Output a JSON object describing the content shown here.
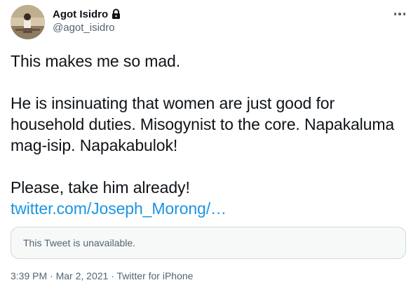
{
  "author": {
    "display_name": "Agot Isidro",
    "handle": "@agot_isidro",
    "protected_icon": "lock-icon",
    "avatar_icon": "profile-photo"
  },
  "menu": {
    "icon": "more-options-icon"
  },
  "tweet": {
    "line1": "This makes me so mad.",
    "paragraph2": "He is insinuating that women are just good for household duties. Misogynist to the core. Napakaluma mag-isip. Napakabulok!",
    "line3": "Please, take him already!",
    "link_text": "twitter.com/Joseph_Morong/…"
  },
  "quoted_tweet": {
    "text": "This Tweet is unavailable."
  },
  "meta": {
    "time": "3:39 PM",
    "separator1": " · ",
    "date": "Mar 2, 2021",
    "separator2": " · ",
    "source": "Twitter for iPhone"
  },
  "colors": {
    "link": "#1b95e0",
    "secondary_text": "#536471",
    "primary_text": "#0f1419",
    "border": "#cfd9de"
  }
}
